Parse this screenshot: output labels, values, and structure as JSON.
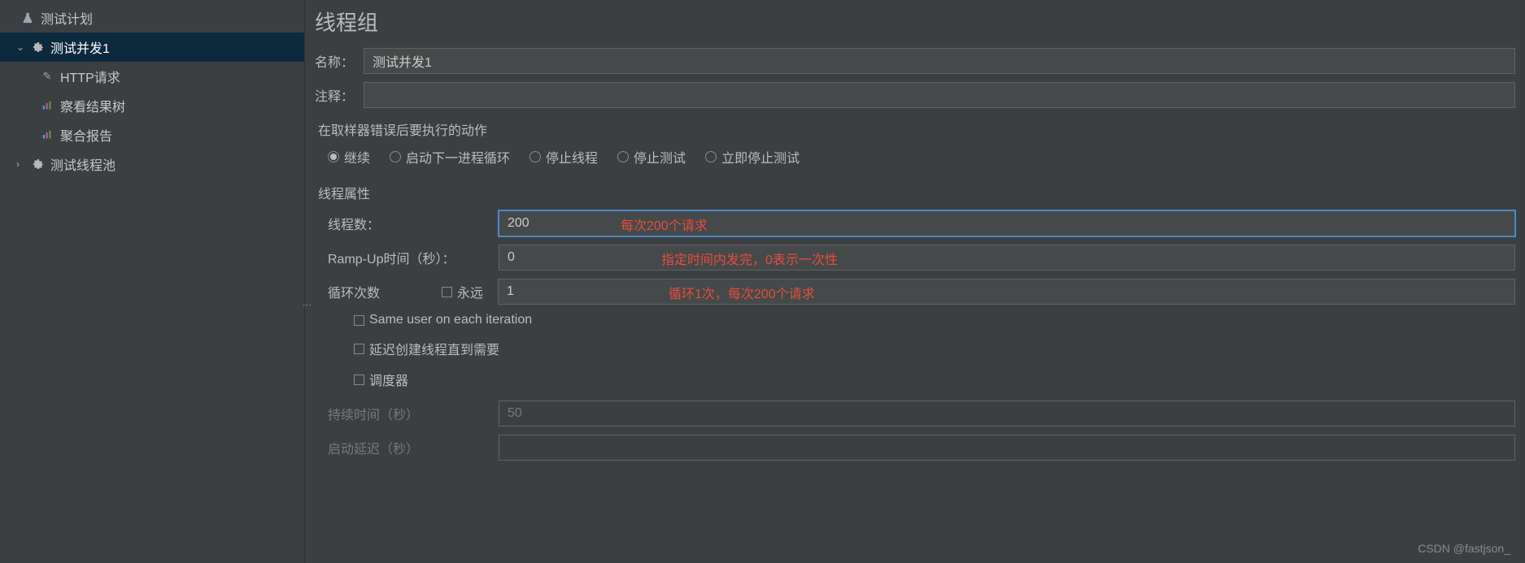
{
  "tree": {
    "root": "测试计划",
    "selected": "测试并发1",
    "children": [
      {
        "label": "HTTP请求",
        "icon": "pencil"
      },
      {
        "label": "察看结果树",
        "icon": "chart"
      },
      {
        "label": "聚合报告",
        "icon": "chart"
      }
    ],
    "sibling": "测试线程池"
  },
  "panel": {
    "title": "线程组",
    "name_label": "名称：",
    "name_value": "测试并发1",
    "comment_label": "注释：",
    "comment_value": ""
  },
  "error_action": {
    "title": "在取样器错误后要执行的动作",
    "options": [
      "继续",
      "启动下一进程循环",
      "停止线程",
      "停止测试",
      "立即停止测试"
    ],
    "selected": 0
  },
  "thread_props": {
    "title": "线程属性",
    "threads_label": "线程数：",
    "threads_value": "200",
    "threads_note": "每次200个请求",
    "rampup_label": "Ramp-Up时间（秒）：",
    "rampup_value": "0",
    "rampup_note": "指定时间内发完，0表示一次性",
    "loop_label": "循环次数",
    "forever_label": "永远",
    "loop_value": "1",
    "loop_note": "循环1次，每次200个请求",
    "same_user": "Same user on each iteration",
    "delay_create": "延迟创建线程直到需要",
    "scheduler": "调度器",
    "duration_label": "持续时间（秒）",
    "duration_value": "50",
    "startup_delay_label": "启动延迟（秒）",
    "startup_delay_value": ""
  },
  "watermark": "CSDN @fastjson_"
}
